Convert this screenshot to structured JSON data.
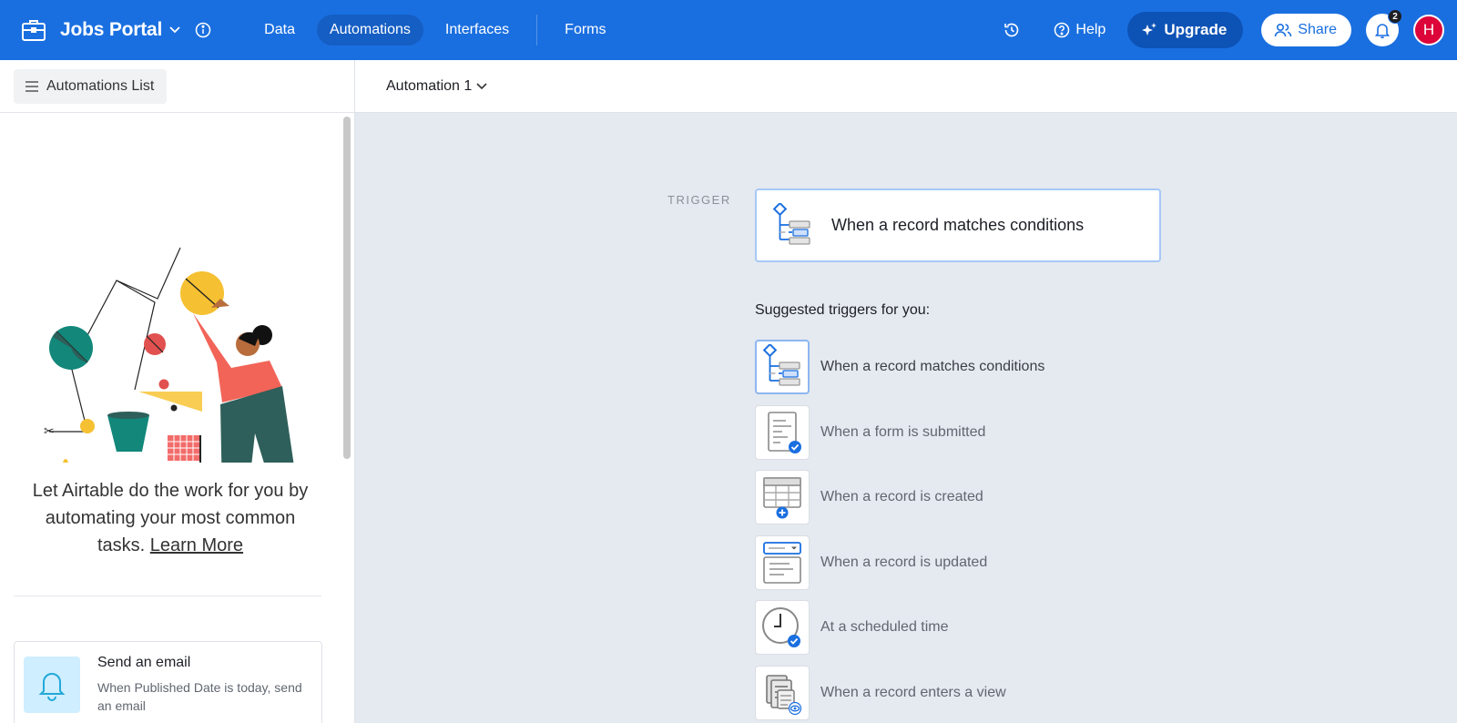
{
  "header": {
    "app_name": "Jobs Portal",
    "nav": [
      {
        "label": "Data",
        "active": false
      },
      {
        "label": "Automations",
        "active": true
      },
      {
        "label": "Interfaces",
        "active": false
      },
      {
        "label": "Forms",
        "active": false
      }
    ],
    "help_label": "Help",
    "upgrade_label": "Upgrade",
    "share_label": "Share",
    "notification_count": "2",
    "avatar_initial": "H",
    "accent_color": "#1a6fe0"
  },
  "sidebar": {
    "list_button_label": "Automations List",
    "promo_text": "Let Airtable do the work for you by automating your most common tasks.",
    "promo_link": "Learn More",
    "template_card": {
      "title": "Send an email",
      "description": "When Published Date is today, send an email"
    }
  },
  "automation": {
    "name": "Automation 1"
  },
  "trigger": {
    "section_label": "TRIGGER",
    "selected": "When a record matches conditions"
  },
  "suggestions": {
    "title": "Suggested triggers for you:",
    "items": [
      {
        "label": "When a record matches conditions",
        "icon": "conditions-icon"
      },
      {
        "label": "When a form is submitted",
        "icon": "form-submitted-icon"
      },
      {
        "label": "When a record is created",
        "icon": "record-created-icon"
      },
      {
        "label": "When a record is updated",
        "icon": "record-updated-icon"
      },
      {
        "label": "At a scheduled time",
        "icon": "scheduled-time-icon"
      },
      {
        "label": "When a record enters a view",
        "icon": "enters-view-icon"
      }
    ]
  }
}
